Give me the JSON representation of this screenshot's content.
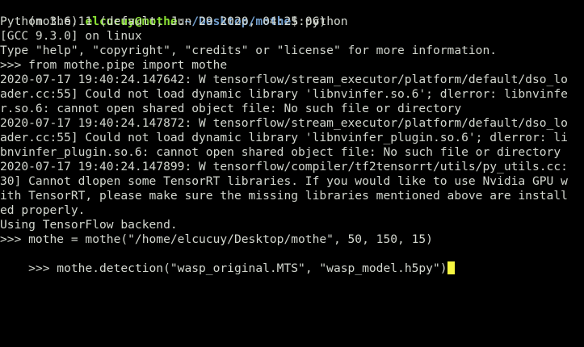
{
  "colors": {
    "background": "#000000",
    "text": "#d3d7cf",
    "prompt_user": "#8ae234",
    "prompt_path": "#729fcf",
    "cursor": "#f6f640"
  },
  "prompt": {
    "env": "(mothe) ",
    "user_host": "elcucuy@mothe",
    "separator": ":",
    "path": "~/Desktop/mothe",
    "symbol": "$ ",
    "command": "python"
  },
  "output_lines": [
    "Python 3.6.11 (default, Jun 29 2020, 04:25:06)",
    "[GCC 9.3.0] on linux",
    "Type \"help\", \"copyright\", \"credits\" or \"license\" for more information.",
    ">>> from mothe.pipe import mothe",
    "2020-07-17 19:40:24.147642: W tensorflow/stream_executor/platform/default/dso_lo",
    "ader.cc:55] Could not load dynamic library 'libnvinfer.so.6'; dlerror: libnvinfe",
    "r.so.6: cannot open shared object file: No such file or directory",
    "2020-07-17 19:40:24.147872: W tensorflow/stream_executor/platform/default/dso_lo",
    "ader.cc:55] Could not load dynamic library 'libnvinfer_plugin.so.6'; dlerror: li",
    "bnvinfer_plugin.so.6: cannot open shared object file: No such file or directory",
    "2020-07-17 19:40:24.147899: W tensorflow/compiler/tf2tensorrt/utils/py_utils.cc:",
    "30] Cannot dlopen some TensorRT libraries. If you would like to use Nvidia GPU w",
    "ith TensorRT, please make sure the missing libraries mentioned above are install",
    "ed properly.",
    "Using TensorFlow backend.",
    ">>> mothe = mothe(\"/home/elcucuy/Desktop/mothe\", 50, 150, 15)"
  ],
  "current_input": ">>> mothe.detection(\"wasp_original.MTS\", \"wasp_model.h5py\")"
}
